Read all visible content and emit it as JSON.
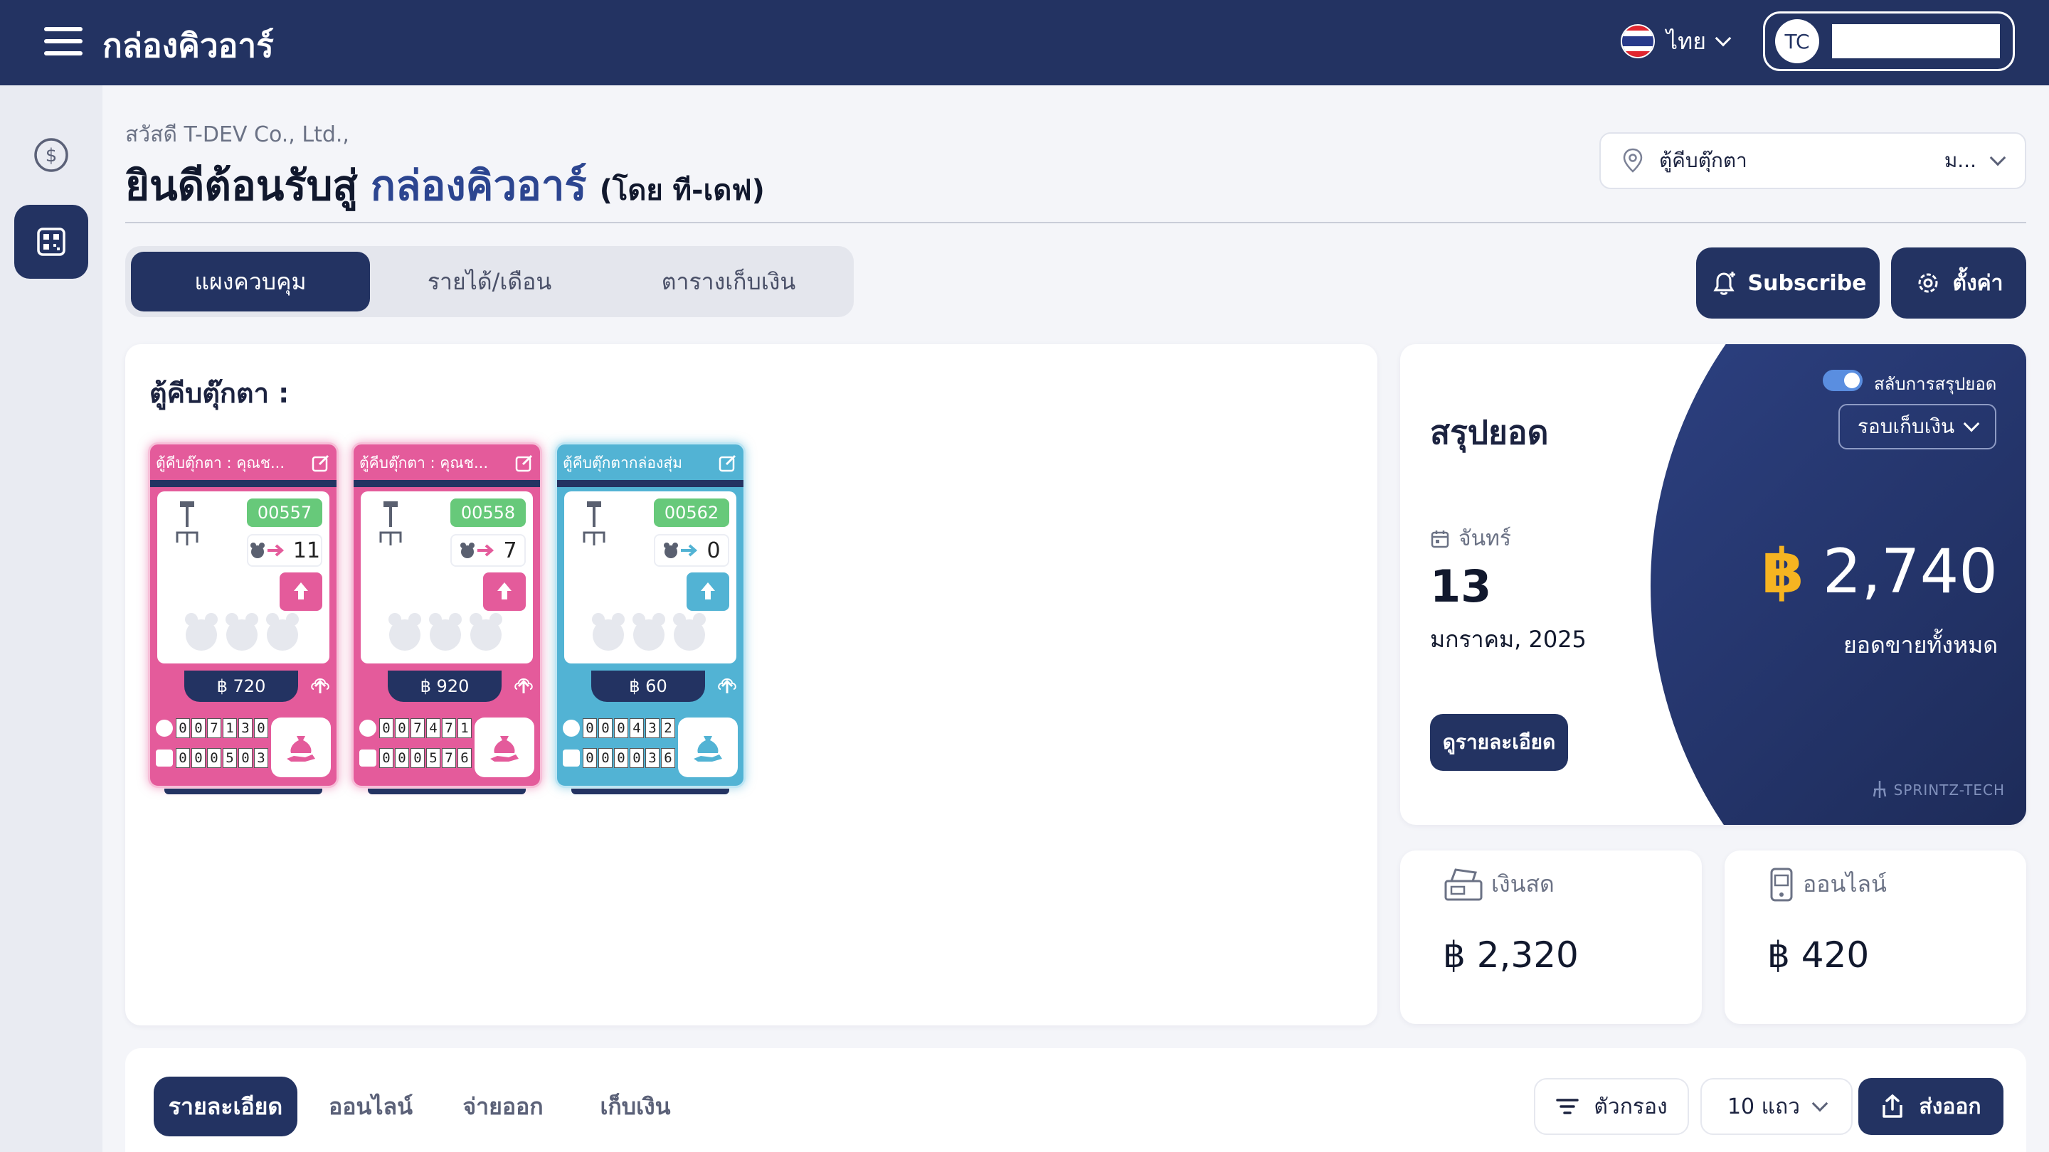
{
  "app": {
    "title": "กล่องคิวอาร์"
  },
  "header": {
    "language": "ไทย",
    "user_initials": "TC",
    "user_name": ""
  },
  "page": {
    "greeting": "สวัสดี T-DEV Co., Ltd.,",
    "welcome_prefix": "ยินดีต้อนรับสู่",
    "welcome_brand": "กล่องคิวอาร์",
    "welcome_suffix": "(โดย ที-เดฟ)",
    "location_text": "ตู้คีบตุ๊กตา",
    "location_extra": "ม..."
  },
  "tabs": [
    {
      "label": "แผงควบคุม",
      "active": true
    },
    {
      "label": "รายได้/เดือน",
      "active": false
    },
    {
      "label": "ตารางเก็บเงิน",
      "active": false
    }
  ],
  "actions": {
    "subscribe": "Subscribe",
    "settings": "ตั้งค่า"
  },
  "machines_panel": {
    "title": "ตู้คีบตุ๊กตา :",
    "machines": [
      {
        "name": "ตู้คีบตุ๊กตา : คุณช...",
        "code": "00557",
        "plays": "11",
        "income": "฿ 720",
        "coin_digits": [
          "0",
          "0",
          "7",
          "1",
          "3",
          "0"
        ],
        "prize_digits": [
          "0",
          "0",
          "0",
          "5",
          "0",
          "3"
        ],
        "theme": "pink"
      },
      {
        "name": "ตู้คีบตุ๊กตา : คุณช...",
        "code": "00558",
        "plays": "7",
        "income": "฿ 920",
        "coin_digits": [
          "0",
          "0",
          "7",
          "4",
          "7",
          "1"
        ],
        "prize_digits": [
          "0",
          "0",
          "0",
          "5",
          "7",
          "6"
        ],
        "theme": "pink"
      },
      {
        "name": "ตู้คีบตุ๊กตากล่องสุ่ม",
        "code": "00562",
        "plays": "0",
        "income": "฿ 60",
        "coin_digits": [
          "0",
          "0",
          "0",
          "4",
          "3",
          "2"
        ],
        "prize_digits": [
          "0",
          "0",
          "0",
          "0",
          "3",
          "6"
        ],
        "theme": "blue"
      }
    ]
  },
  "summary": {
    "title": "สรุปยอด",
    "toggle_label": "สลับการสรุปยอด",
    "round_select": "รอบเก็บเงิน",
    "day": "จันทร์",
    "date": "13",
    "month_year": "มกราคม, 2025",
    "detail_button": "ดูรายละเอียด",
    "currency": "฿",
    "total": "2,740",
    "total_label": "ยอดขายทั้งหมด",
    "watermark": "SPRINTZ-TECH"
  },
  "cash": {
    "label": "เงินสด",
    "value": "฿ 2,320"
  },
  "online": {
    "label": "ออนไลน์",
    "value": "฿ 420"
  },
  "bottom": {
    "tabs": [
      {
        "label": "รายละเอียด",
        "active": true
      },
      {
        "label": "ออนไลน์",
        "active": false
      },
      {
        "label": "จ่ายออก",
        "active": false
      },
      {
        "label": "เก็บเงิน",
        "active": false
      }
    ],
    "filter": "ตัวกรอง",
    "rows": "10 แถว",
    "export": "ส่งออก"
  },
  "colors": {
    "navy": "#233362",
    "pink": "#e45b9b",
    "blue": "#52b3d4",
    "gold": "#f6b421",
    "green": "#67c97a"
  }
}
